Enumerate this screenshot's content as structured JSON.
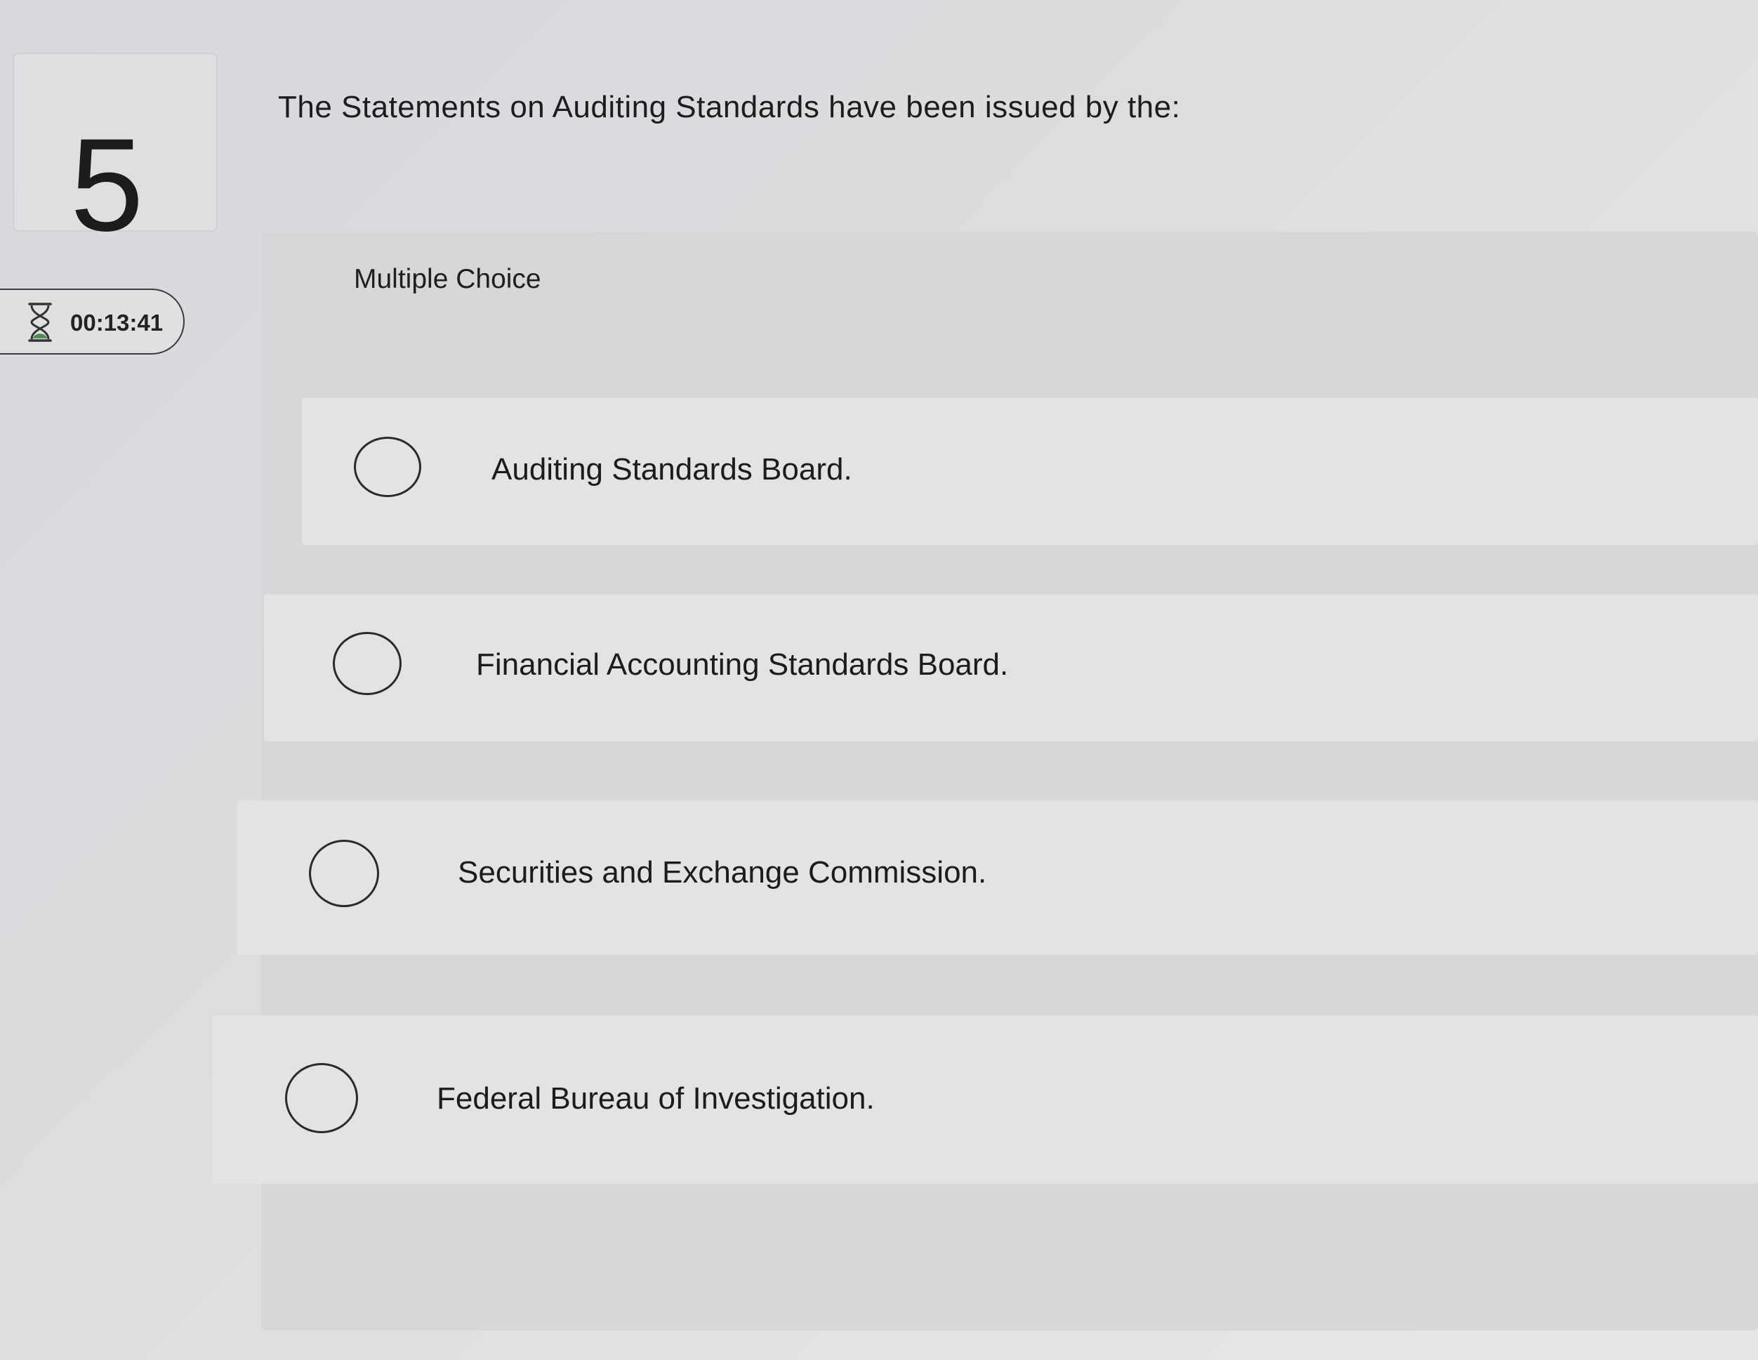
{
  "question": {
    "number": "5",
    "text": "The Statements on Auditing Standards have been issued by the:",
    "type_label": "Multiple Choice"
  },
  "timer": {
    "icon": "hourglass-icon",
    "value": "00:13:41"
  },
  "options": [
    {
      "label": "Auditing Standards Board.",
      "selected": false
    },
    {
      "label": "Financial Accounting Standards Board.",
      "selected": false
    },
    {
      "label": "Securities and Exchange Commission.",
      "selected": false
    },
    {
      "label": "Federal Bureau of Investigation.",
      "selected": false
    }
  ]
}
